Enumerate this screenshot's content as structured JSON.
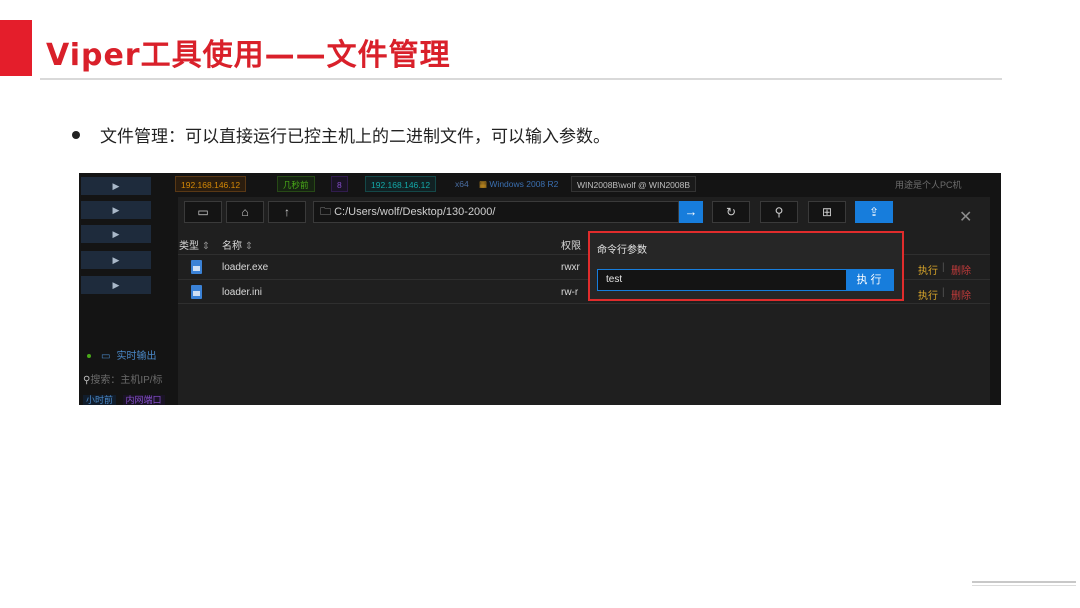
{
  "slide": {
    "title": "Viper工具使用——文件管理",
    "bullet": "文件管理：可以直接运行已控主机上的二进制文件，可以输入参数。"
  },
  "colors": {
    "accent_red": "#d9202a",
    "primary_blue": "#177ddc",
    "exec_gold": "#d8a52a",
    "delete_red": "#c23b3b"
  },
  "app": {
    "sidebar_arrow": "▶",
    "host_ip": "192.168.146.12",
    "last_seen": "几秒前",
    "session_count": "8",
    "host_ip2": "192.168.146.12",
    "arch": "x64",
    "os_icon": "windows-icon",
    "os": "Windows 2008 R2",
    "user": "WIN2008B\\wolf @ WIN2008B",
    "right_hint": "用途是个人PC机",
    "realtime_output": "实时输出",
    "search_placeholder": "搜索：主机IP/标",
    "bottom_tag1": "小时前",
    "bottom_tag2": "内网端口",
    "file_manager": {
      "path": "C:/Users/wolf/Desktop/130-2000/",
      "icons": {
        "desktop": "desktop-icon",
        "home": "home-icon",
        "up": "arrow-up-icon",
        "go": "arrow-right-icon",
        "refresh": "refresh-icon",
        "pin": "pin-icon",
        "new_folder": "folder-add-icon",
        "upload": "upload-icon",
        "close": "close-icon"
      },
      "columns": {
        "type": "类型",
        "name": "名称",
        "perm": "权限"
      },
      "files": [
        {
          "name": "loader.exe",
          "perm": "rwxr",
          "exec": "执行",
          "delete": "删除"
        },
        {
          "name": "loader.ini",
          "perm": "rw-r",
          "exec": "执行",
          "delete": "删除"
        }
      ],
      "popover": {
        "title": "命令行参数",
        "input_value": "test",
        "exec_button": "执行"
      }
    }
  }
}
